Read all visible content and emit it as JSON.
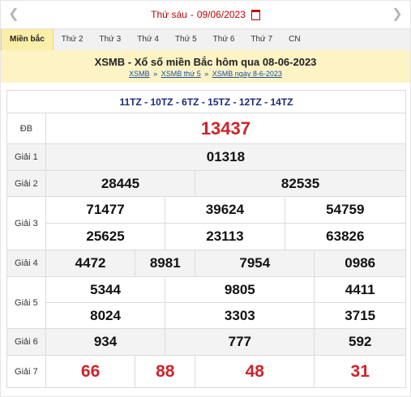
{
  "date_bar": {
    "day": "Thứ sáu",
    "separator": "-",
    "date": "09/06/2023",
    "prev_icon": "chevron-left-icon",
    "next_icon": "chevron-right-icon",
    "calendar_icon": "calendar-icon"
  },
  "tabs": [
    "Miền bắc",
    "Thứ 2",
    "Thứ 3",
    "Thứ 4",
    "Thứ 5",
    "Thứ 6",
    "Thứ 7",
    "CN"
  ],
  "header": {
    "title": "XSMB - Xổ số miền Bắc hôm qua 08-06-2023",
    "crumbs": [
      "XSMB",
      "XSMB thứ 5",
      "XSMB ngày 8-6-2023"
    ],
    "crumb_sep": "»"
  },
  "codes": "11TZ - 10TZ - 6TZ - 15TZ - 12TZ - 14TZ",
  "prizes": {
    "db": {
      "label": "ĐB",
      "values": [
        "13437"
      ]
    },
    "g1": {
      "label": "Giải 1",
      "values": [
        "01318"
      ]
    },
    "g2": {
      "label": "Giải 2",
      "values": [
        "28445",
        "82535"
      ]
    },
    "g3": {
      "label": "Giải 3",
      "values": [
        "71477",
        "39624",
        "54759",
        "25625",
        "23113",
        "63826"
      ]
    },
    "g4": {
      "label": "Giải 4",
      "values": [
        "4472",
        "8981",
        "7954",
        "0986"
      ]
    },
    "g5": {
      "label": "Giải 5",
      "values": [
        "5344",
        "9805",
        "4411",
        "8024",
        "3303",
        "3715"
      ]
    },
    "g6": {
      "label": "Giải 6",
      "values": [
        "934",
        "777",
        "592"
      ]
    },
    "g7": {
      "label": "Giải 7",
      "values": [
        "66",
        "88",
        "48",
        "31"
      ]
    }
  },
  "colors": {
    "accent_red": "#d0232a",
    "tab_active": "#fbeea8",
    "header_bg": "#fdf3c4",
    "codes_blue": "#1a2a7a",
    "link_blue": "#1a4fa0"
  }
}
